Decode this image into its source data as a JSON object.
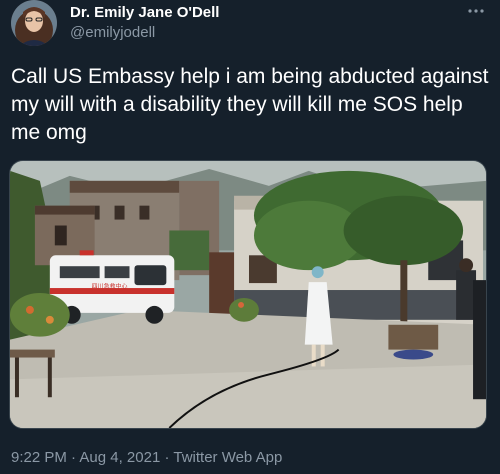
{
  "author": {
    "display_name": "Dr. Emily Jane O'Dell",
    "handle": "@emilyjodell",
    "avatar_icon": "profile-photo"
  },
  "more_icon": "more-horizontal-icon",
  "tweet": {
    "text": "Call US Embassy help i am being abducted against my will with a disability they will kill me SOS help me omg"
  },
  "media": {
    "description_icon": "photo",
    "ambulance_sign": "四川急救中心"
  },
  "meta": {
    "time": "9:22 PM",
    "separator1": " · ",
    "date": "Aug 4, 2021",
    "separator2": " · ",
    "app": "Twitter Web App"
  },
  "colors": {
    "background": "#15202b",
    "secondary_text": "#8b98a5",
    "primary_text": "#ffffff",
    "border": "#38444d"
  }
}
